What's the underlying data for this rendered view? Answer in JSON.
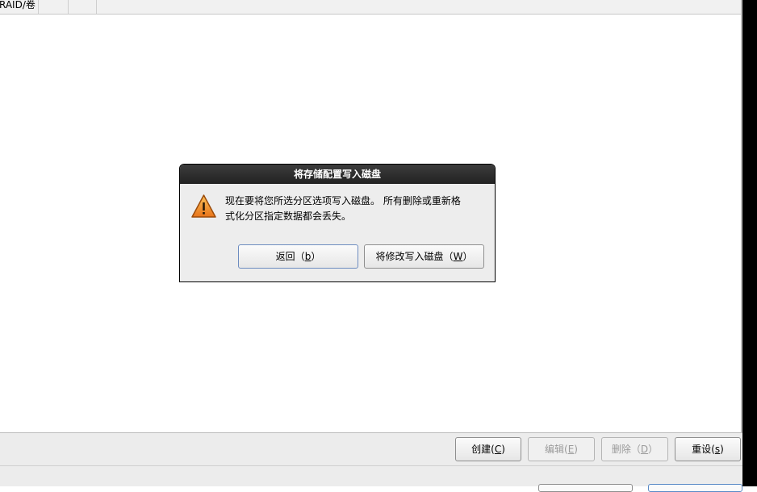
{
  "table_header": {
    "columns": [
      "RAID/卷",
      "",
      ""
    ]
  },
  "toolbar": {
    "create": {
      "label": "创建",
      "mnemonic": "C"
    },
    "edit": {
      "label": "编辑",
      "mnemonic": "E"
    },
    "delete": {
      "label": "删除",
      "mnemonic": "D"
    },
    "reset": {
      "label": "重设",
      "mnemonic": "s"
    }
  },
  "dialog": {
    "title": "将存储配置写入磁盘",
    "icon": "warning-icon",
    "message_line1": "现在要将您所选分区选项写入磁盘。 所有删除或重新格",
    "message_line2": "式化分区指定数据都会丢失。",
    "back_button": {
      "label": "返回",
      "mnemonic": "b"
    },
    "write_button": {
      "label": "将修改写入磁盘",
      "mnemonic": "W"
    }
  },
  "colors": {
    "warning_fill": "#f5a623",
    "title_bar": "#2b2b2b",
    "focus_border": "#6d8cc0"
  }
}
